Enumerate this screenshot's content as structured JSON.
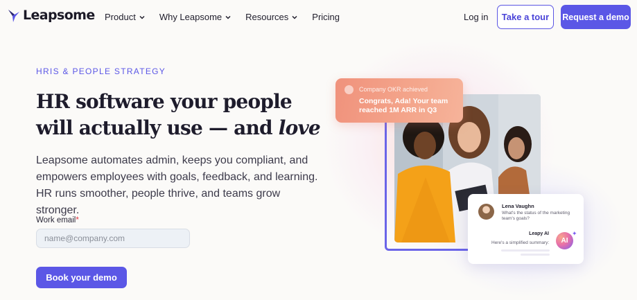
{
  "nav": {
    "logo": "Leapsome",
    "items": [
      {
        "label": "Product",
        "dropdown": true
      },
      {
        "label": "Why Leapsome",
        "dropdown": true
      },
      {
        "label": "Resources",
        "dropdown": true
      },
      {
        "label": "Pricing",
        "dropdown": false
      }
    ],
    "login": "Log in",
    "tour_button": "Take a tour",
    "demo_button": "Request a demo"
  },
  "hero": {
    "eyebrow": "HRIS & PEOPLE STRATEGY",
    "headline_line1": "HR software your people",
    "headline_line2_pre": "will actually use — and ",
    "headline_line2_em": "love",
    "subtext": "Leapsome automates admin, keeps you compliant, and empowers employees with goals, feedback, and learning. HR runs smoother, people thrive, and teams grow stronger.",
    "email_label": "Work email",
    "email_required_mark": "*",
    "email_placeholder": "name@company.com",
    "cta": "Book your demo"
  },
  "visual": {
    "toast_title": "Company OKR achieved",
    "toast_message": "Congrats, Ada! Your team reached 1M ARR in Q3",
    "chat_user_name": "Lena Vaughn",
    "chat_user_question": "What's the status of the marketing team's goals?",
    "assistant_name": "Leapy AI",
    "assistant_message": "Here's a simplified summary:",
    "ai_badge": "AI"
  },
  "colors": {
    "accent": "#5b57e6",
    "toast": "#f0927c",
    "background": "#fbfaf8"
  }
}
